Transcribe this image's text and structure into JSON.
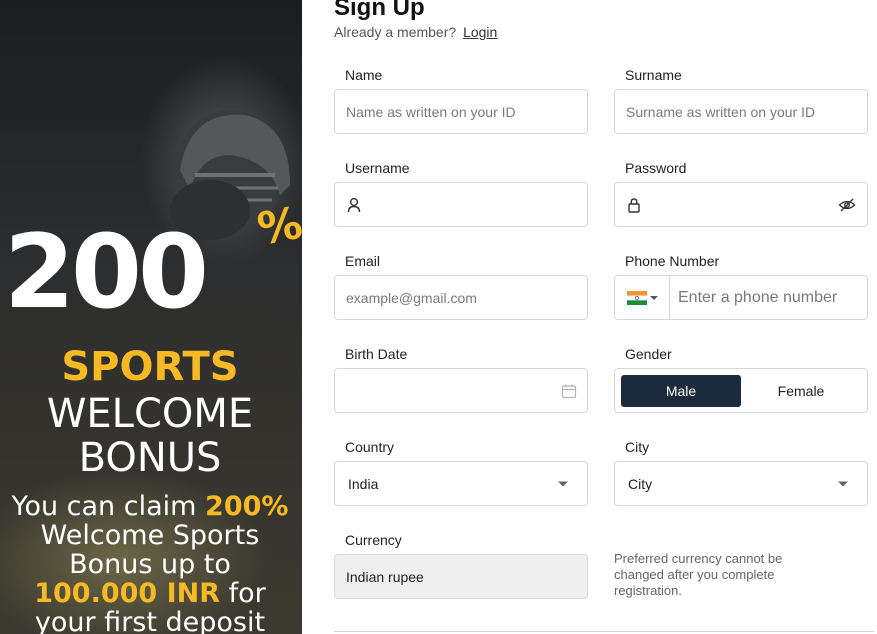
{
  "banner": {
    "big_number": "200",
    "percent": "%",
    "sports": "SPORTS",
    "welcome": "WELCOME",
    "bonus": "BONUS",
    "claim_line1_prefix": "You can claim ",
    "claim_line1_highlight": "200%",
    "claim_line2": "Welcome Sports",
    "claim_line3": "Bonus up to",
    "claim_line4_highlight": "100.000 INR",
    "claim_line4_suffix": " for",
    "claim_line5": "your first deposit"
  },
  "header": {
    "title": "Sign Up",
    "member_text": "Already a member?",
    "login_link": "Login"
  },
  "fields": {
    "name": {
      "label": "Name",
      "placeholder": "Name as written on your ID",
      "value": ""
    },
    "surname": {
      "label": "Surname",
      "placeholder": "Surname as written on your ID",
      "value": ""
    },
    "username": {
      "label": "Username",
      "placeholder": "",
      "value": ""
    },
    "password": {
      "label": "Password",
      "placeholder": "",
      "value": ""
    },
    "email": {
      "label": "Email",
      "placeholder": "example@gmail.com",
      "value": ""
    },
    "phone": {
      "label": "Phone Number",
      "placeholder": "Enter a phone number",
      "value": "",
      "country_flag": "india-flag"
    },
    "birth_date": {
      "label": "Birth Date",
      "placeholder": "",
      "value": ""
    },
    "gender": {
      "label": "Gender",
      "options": [
        "Male",
        "Female"
      ],
      "selected": "Male"
    },
    "country": {
      "label": "Country",
      "value": "India"
    },
    "city": {
      "label": "City",
      "value": "City"
    },
    "currency": {
      "label": "Currency",
      "value": "Indian rupee",
      "note": "Preferred currency cannot be changed after you complete registration."
    }
  },
  "colors": {
    "accent_dark": "#1b2a3d",
    "banner_yellow": "#f7b924",
    "border": "#d5d7db"
  }
}
